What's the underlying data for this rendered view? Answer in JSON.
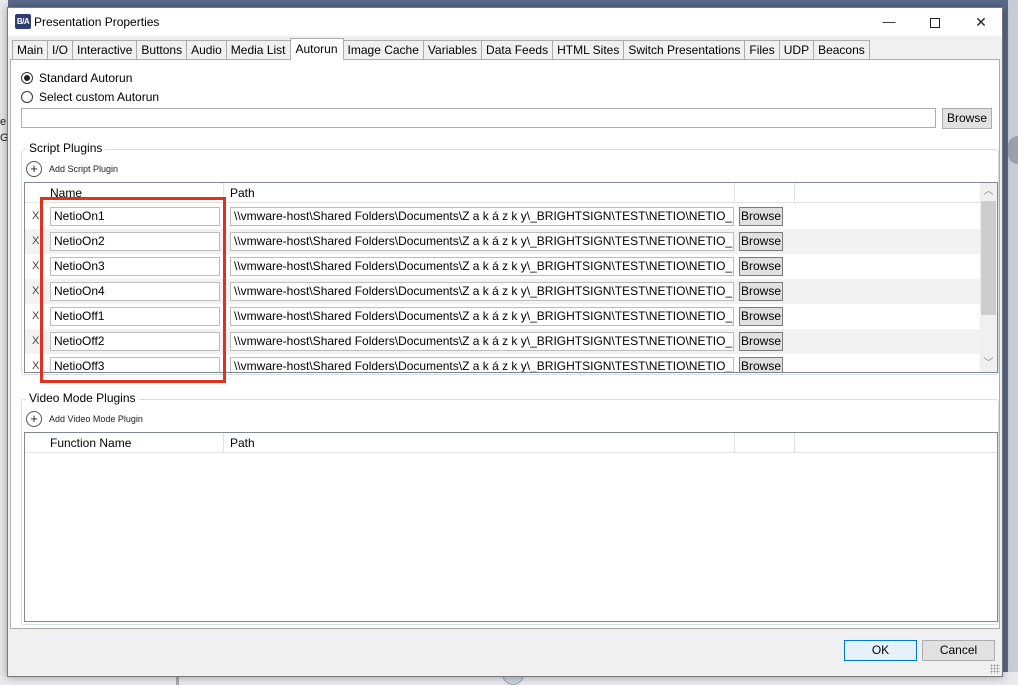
{
  "window": {
    "icon_text": "B/A",
    "title": "Presentation Properties",
    "controls": {
      "minimize": "—",
      "close": "✕"
    }
  },
  "background": {
    "letter_e": "e",
    "letter_g": "G"
  },
  "tabs": [
    {
      "label": "Main"
    },
    {
      "label": "I/O"
    },
    {
      "label": "Interactive"
    },
    {
      "label": "Buttons"
    },
    {
      "label": "Audio"
    },
    {
      "label": "Media List"
    },
    {
      "label": "Autorun",
      "active": true
    },
    {
      "label": "Image Cache"
    },
    {
      "label": "Variables"
    },
    {
      "label": "Data Feeds"
    },
    {
      "label": "HTML Sites"
    },
    {
      "label": "Switch Presentations"
    },
    {
      "label": "Files"
    },
    {
      "label": "UDP"
    },
    {
      "label": "Beacons"
    }
  ],
  "autorun": {
    "standard_label": "Standard Autorun",
    "custom_label": "Select custom Autorun",
    "selected": "standard",
    "custom_path_value": "",
    "browse_label": "Browse"
  },
  "script_plugins": {
    "title": "Script Plugins",
    "add_label": "Add Script Plugin",
    "columns": {
      "name": "Name",
      "path": "Path"
    },
    "remove_label": "X",
    "browse_label": "Browse",
    "rows": [
      {
        "name": "NetioOn1",
        "path": "\\\\vmware-host\\Shared Folders\\Documents\\Z a k á z k y\\_BRIGHTSIGN\\TEST\\NETIO\\NETIO_Plu"
      },
      {
        "name": "NetioOn2",
        "path": "\\\\vmware-host\\Shared Folders\\Documents\\Z a k á z k y\\_BRIGHTSIGN\\TEST\\NETIO\\NETIO_Plu"
      },
      {
        "name": "NetioOn3",
        "path": "\\\\vmware-host\\Shared Folders\\Documents\\Z a k á z k y\\_BRIGHTSIGN\\TEST\\NETIO\\NETIO_Plu"
      },
      {
        "name": "NetioOn4",
        "path": "\\\\vmware-host\\Shared Folders\\Documents\\Z a k á z k y\\_BRIGHTSIGN\\TEST\\NETIO\\NETIO_Plu"
      },
      {
        "name": "NetioOff1",
        "path": "\\\\vmware-host\\Shared Folders\\Documents\\Z a k á z k y\\_BRIGHTSIGN\\TEST\\NETIO\\NETIO_Plu"
      },
      {
        "name": "NetioOff2",
        "path": "\\\\vmware-host\\Shared Folders\\Documents\\Z a k á z k y\\_BRIGHTSIGN\\TEST\\NETIO\\NETIO_Plu"
      },
      {
        "name": "NetioOff3",
        "path": "\\\\vmware-host\\Shared Folders\\Documents\\Z a k á z k y\\_BRIGHTSIGN\\TEST\\NETIO\\NETIO_Plu"
      }
    ]
  },
  "video_mode_plugins": {
    "title": "Video Mode Plugins",
    "add_label": "Add Video Mode Plugin",
    "columns": {
      "function_name": "Function Name",
      "path": "Path"
    }
  },
  "footer": {
    "ok_label": "OK",
    "cancel_label": "Cancel"
  },
  "colors": {
    "highlight": "#e0301e",
    "ok_border": "#0078d7",
    "app_icon": "#2f3b73"
  }
}
